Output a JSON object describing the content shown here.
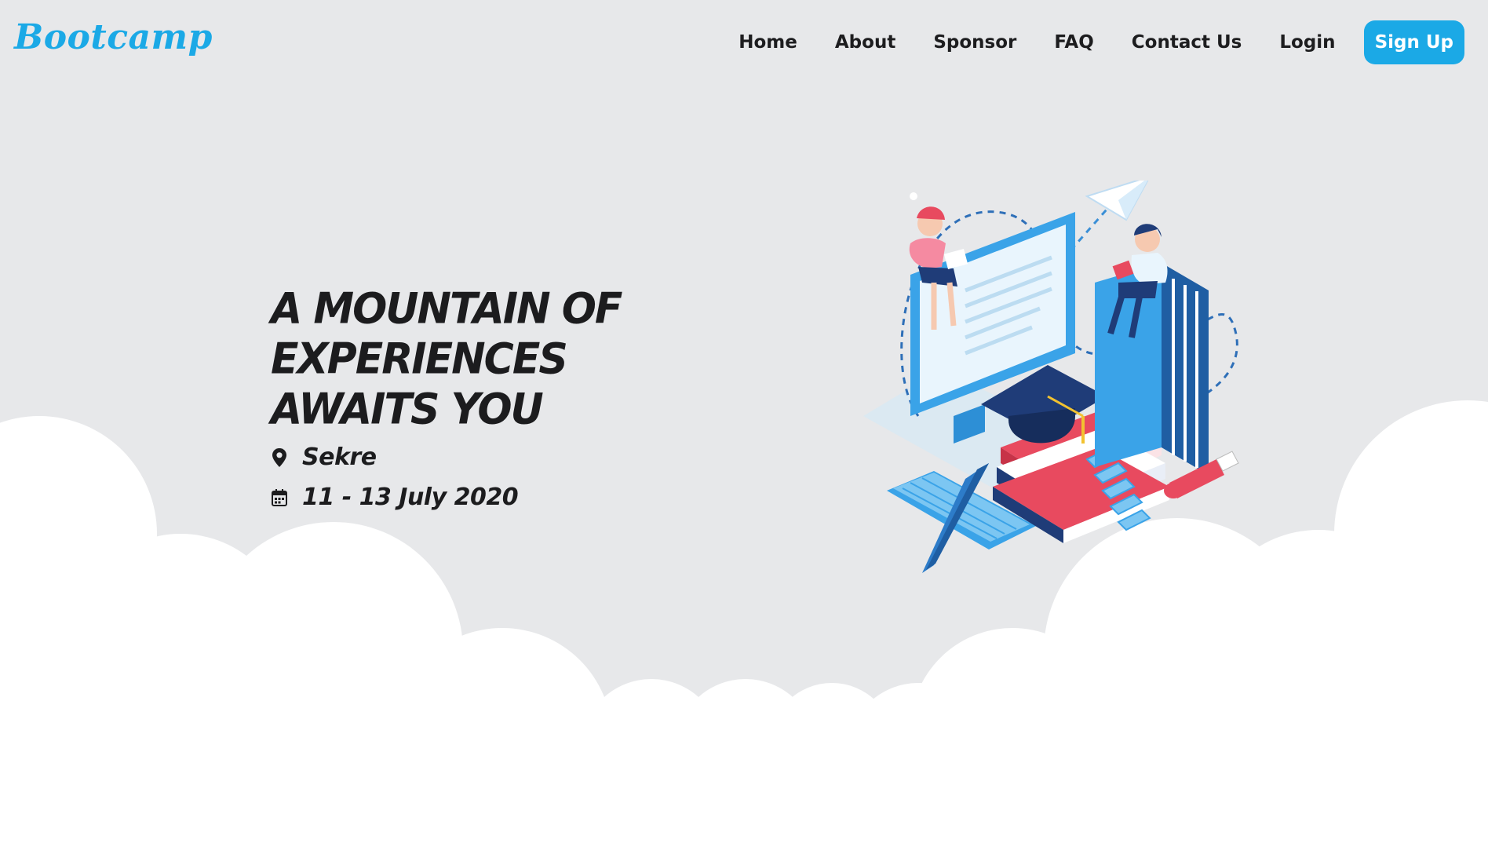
{
  "brand": {
    "name": "Bootcamp"
  },
  "nav": {
    "links": [
      "Home",
      "About",
      "Sponsor",
      "FAQ",
      "Contact Us",
      "Login"
    ],
    "signup_label": "Sign Up"
  },
  "hero": {
    "headline_line1": "A Mountain of",
    "headline_line2": "Experiences Awaits You",
    "location": "Sekre",
    "date": "11 - 13 July 2020"
  },
  "icons": {
    "location": "map-pin-icon",
    "date": "calendar-icon"
  },
  "colors": {
    "accent": "#1ba9e6",
    "background": "#e7e8ea",
    "cloud": "#ffffff",
    "text": "#1c1c1e"
  }
}
